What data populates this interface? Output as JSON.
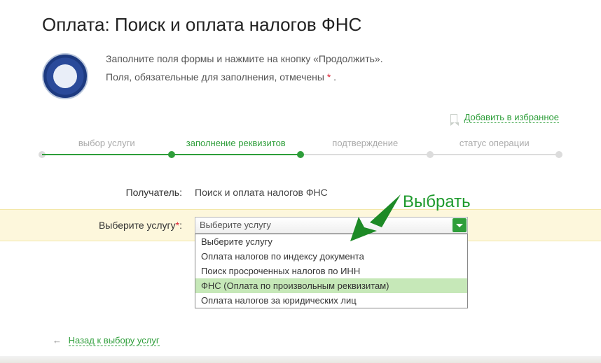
{
  "title": "Оплата: Поиск и оплата налогов ФНС",
  "intro": {
    "line1_a": "Заполните поля формы и нажмите на кнопку «Продолжить».",
    "line2_a": "Поля, обязательные для заполнения, отмечены ",
    "asterisk": "*",
    "line2_b": " ."
  },
  "favorite": {
    "label": "Добавить в избранное"
  },
  "stepper": {
    "s1": "выбор услуги",
    "s2": "заполнение реквизитов",
    "s3": "подтверждение",
    "s4": "статус операции"
  },
  "recipient": {
    "label": "Получатель:",
    "value": "Поиск и оплата налогов ФНС"
  },
  "service_select": {
    "label": "Выберите услугу",
    "required_mark": "*",
    "label_suffix": ":",
    "current": "Выберите услугу",
    "options": [
      "Выберите услугу",
      "Оплата налогов по индексу документа",
      "Поиск просроченных налогов по ИНН",
      "ФНС (Оплата по произвольным реквизитам)",
      "Оплата налогов за юридических лиц"
    ],
    "highlighted_index": 3
  },
  "annotation": {
    "select_hint": "Выбрать"
  },
  "back": {
    "label": "Назад к выбору услуг"
  }
}
